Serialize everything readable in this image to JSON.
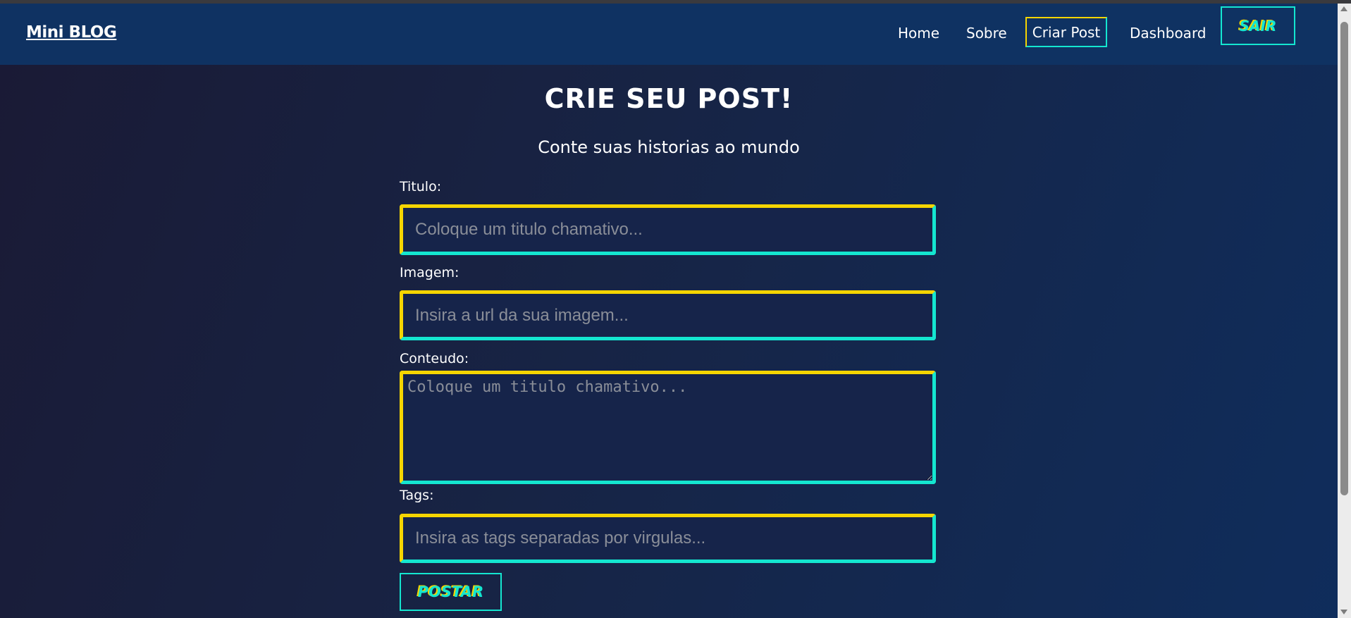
{
  "navbar": {
    "brand": "Mini BLOG",
    "links": [
      {
        "label": "Home"
      },
      {
        "label": "Sobre"
      },
      {
        "label": "Criar Post",
        "active": true
      },
      {
        "label": "Dashboard"
      }
    ],
    "logout_label": "SAIR"
  },
  "main": {
    "title": "CRIE SEU POST!",
    "subtitle": "Conte suas historias ao mundo"
  },
  "form": {
    "title": {
      "label": "Titulo:",
      "placeholder": "Coloque um titulo chamativo...",
      "value": ""
    },
    "image": {
      "label": "Imagem:",
      "placeholder": "Insira a url da sua imagem...",
      "value": ""
    },
    "content": {
      "label": "Conteudo:",
      "placeholder": "Coloque um titulo chamativo...",
      "value": ""
    },
    "tags": {
      "label": "Tags:",
      "placeholder": "Insira as tags separadas por virgulas...",
      "value": ""
    },
    "submit_label": "POSTAR"
  },
  "colors": {
    "accent_yellow": "#f5d500",
    "accent_cyan": "#14e6d0",
    "navbar_bg": "#0f3262"
  },
  "icons": {
    "scroll_up": "scroll-up-arrow-icon",
    "scroll_down": "scroll-down-arrow-icon"
  }
}
